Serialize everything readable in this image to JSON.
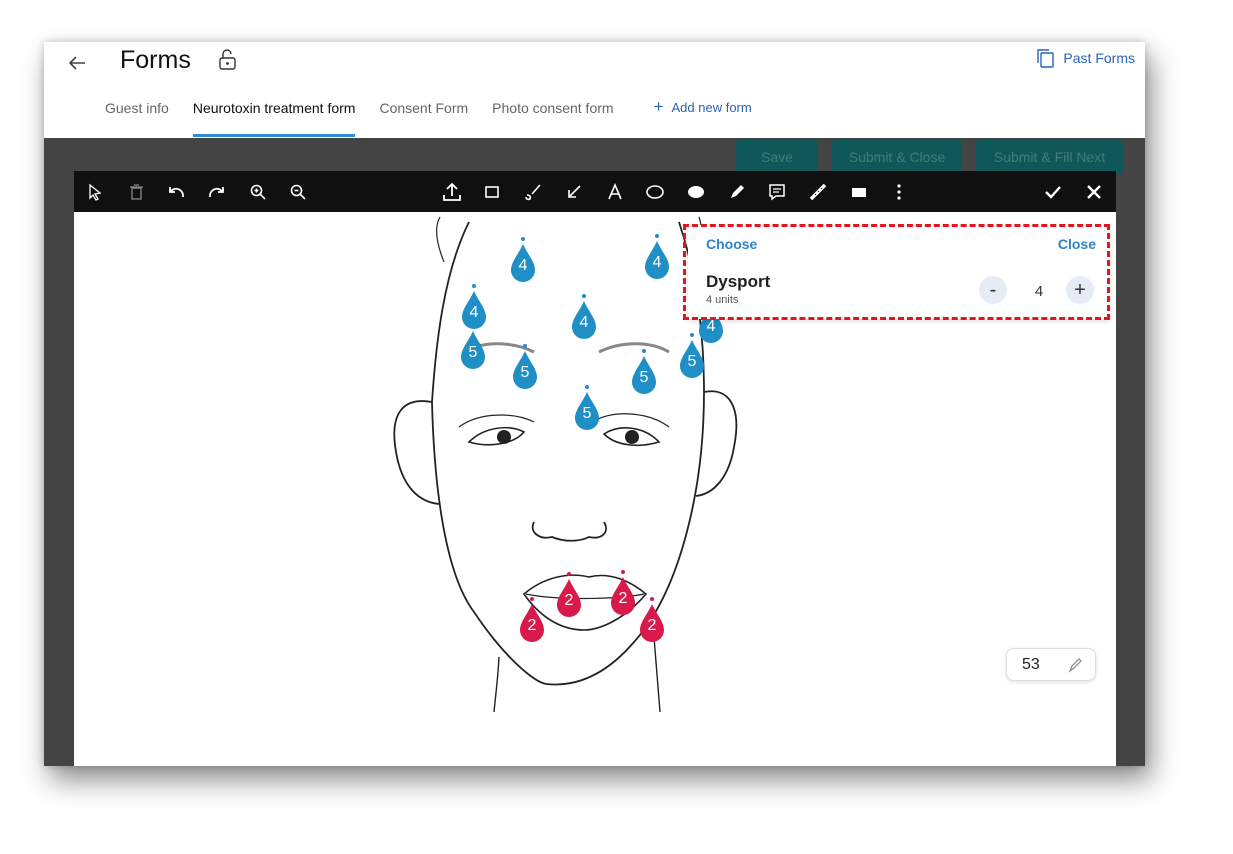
{
  "header": {
    "title": "Forms",
    "past_forms_label": "Past Forms"
  },
  "tabs": [
    {
      "label": "Guest info",
      "active": false
    },
    {
      "label": "Neurotoxin treatment form",
      "active": true
    },
    {
      "label": "Consent Form",
      "active": false
    },
    {
      "label": "Photo consent form",
      "active": false
    }
  ],
  "add_form_label": "Add new form",
  "actions": {
    "save": "Save",
    "submit_close": "Submit & Close",
    "submit_fill_next": "Submit & Fill Next"
  },
  "toolbar": {
    "left_tools": [
      "select-icon",
      "trash-icon",
      "undo-icon",
      "redo-icon",
      "zoom-in-icon",
      "zoom-out-icon"
    ],
    "center_tools": [
      "upload-icon",
      "rectangle-icon",
      "brush-icon",
      "arrow-icon",
      "text-icon",
      "ellipse-icon",
      "filled-ellipse-icon",
      "pen-icon",
      "comment-icon",
      "ruler-icon",
      "filled-rect-icon",
      "more-icon"
    ],
    "right_tools": [
      "check-icon",
      "close-icon"
    ]
  },
  "injection_points": {
    "blue": [
      "4",
      "4",
      "4",
      "4",
      "5",
      "5",
      "5",
      "5",
      "5",
      "4"
    ],
    "red": [
      "2",
      "2",
      "2",
      "2"
    ]
  },
  "popup": {
    "choose_label": "Choose",
    "close_label": "Close",
    "product_name": "Dysport",
    "product_units": "4 units",
    "decrement_label": "-",
    "quantity": "4",
    "increment_label": "+"
  },
  "total_units": "53",
  "colors": {
    "accent_blue": "#2e84c8",
    "drop_blue": "#1f8fc6",
    "drop_red": "#d81a4a",
    "highlight": "#e4141e",
    "action_teal": "#10575a"
  }
}
